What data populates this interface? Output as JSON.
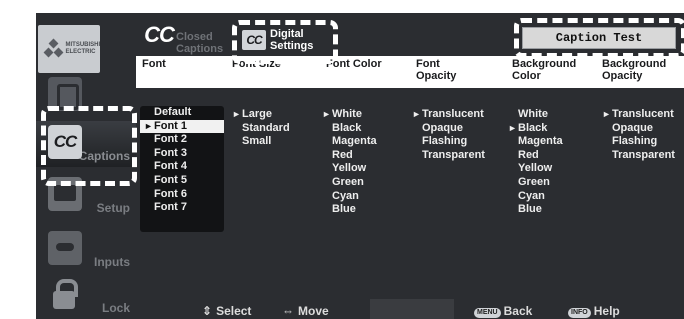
{
  "window": {
    "caption_test": "Caption Test"
  },
  "brand": {
    "logo_text": "MITSUBISHI ELECTRIC"
  },
  "sidebar": {
    "items": [
      {
        "name": "speaker",
        "label": "",
        "icon": "speaker-icon"
      },
      {
        "name": "captions",
        "label": "Captions",
        "icon": "cc-icon",
        "selected": true
      },
      {
        "name": "setup",
        "label": "Setup",
        "icon": "monitor-icon"
      },
      {
        "name": "inputs",
        "label": "Inputs",
        "icon": "inputs-icon"
      },
      {
        "name": "lock",
        "label": "Lock",
        "icon": "lock-icon"
      }
    ]
  },
  "tabs": {
    "closed_captions_line1": "Closed",
    "closed_captions_line2": "Captions",
    "digital_settings_line1": "Digital",
    "digital_settings_line2": "Settings",
    "cc_logo": "CC"
  },
  "columns": {
    "headers": [
      {
        "line1": "Font",
        "line2": ""
      },
      {
        "line1": "Font Size",
        "line2": ""
      },
      {
        "line1": "Font Color",
        "line2": ""
      },
      {
        "line1": "Font",
        "line2": "Opacity"
      },
      {
        "line1": "Background",
        "line2": "Color"
      },
      {
        "line1": "Background",
        "line2": "Opacity"
      }
    ],
    "font": {
      "options": [
        "Default",
        "Font 1",
        "Font 2",
        "Font 3",
        "Font 4",
        "Font 5",
        "Font 6",
        "Font 7"
      ],
      "selected": "Font 1"
    },
    "font_size": {
      "options": [
        "Large",
        "Standard",
        "Small"
      ],
      "selected": "Large"
    },
    "font_color": {
      "options": [
        "White",
        "Black",
        "Magenta",
        "Red",
        "Yellow",
        "Green",
        "Cyan",
        "Blue"
      ],
      "selected": "White"
    },
    "font_opacity": {
      "options": [
        "Translucent",
        "Opaque",
        "Flashing",
        "Transparent"
      ],
      "selected": "Translucent"
    },
    "background_color": {
      "options": [
        "White",
        "Black",
        "Magenta",
        "Red",
        "Yellow",
        "Green",
        "Cyan",
        "Blue"
      ],
      "selected": "Black"
    },
    "background_opacity": {
      "options": [
        "Translucent",
        "Opaque",
        "Flashing",
        "Transparent"
      ],
      "selected": "Translucent"
    }
  },
  "footer": {
    "select_label": "Select",
    "move_label": "Move",
    "back_key": "MENU",
    "back_label": "Back",
    "help_key": "INFO",
    "help_label": "Help"
  },
  "colors": {
    "screen_bg": "#2b2d31",
    "header_bg": "#ffffff",
    "highlight": "#ffffff"
  }
}
